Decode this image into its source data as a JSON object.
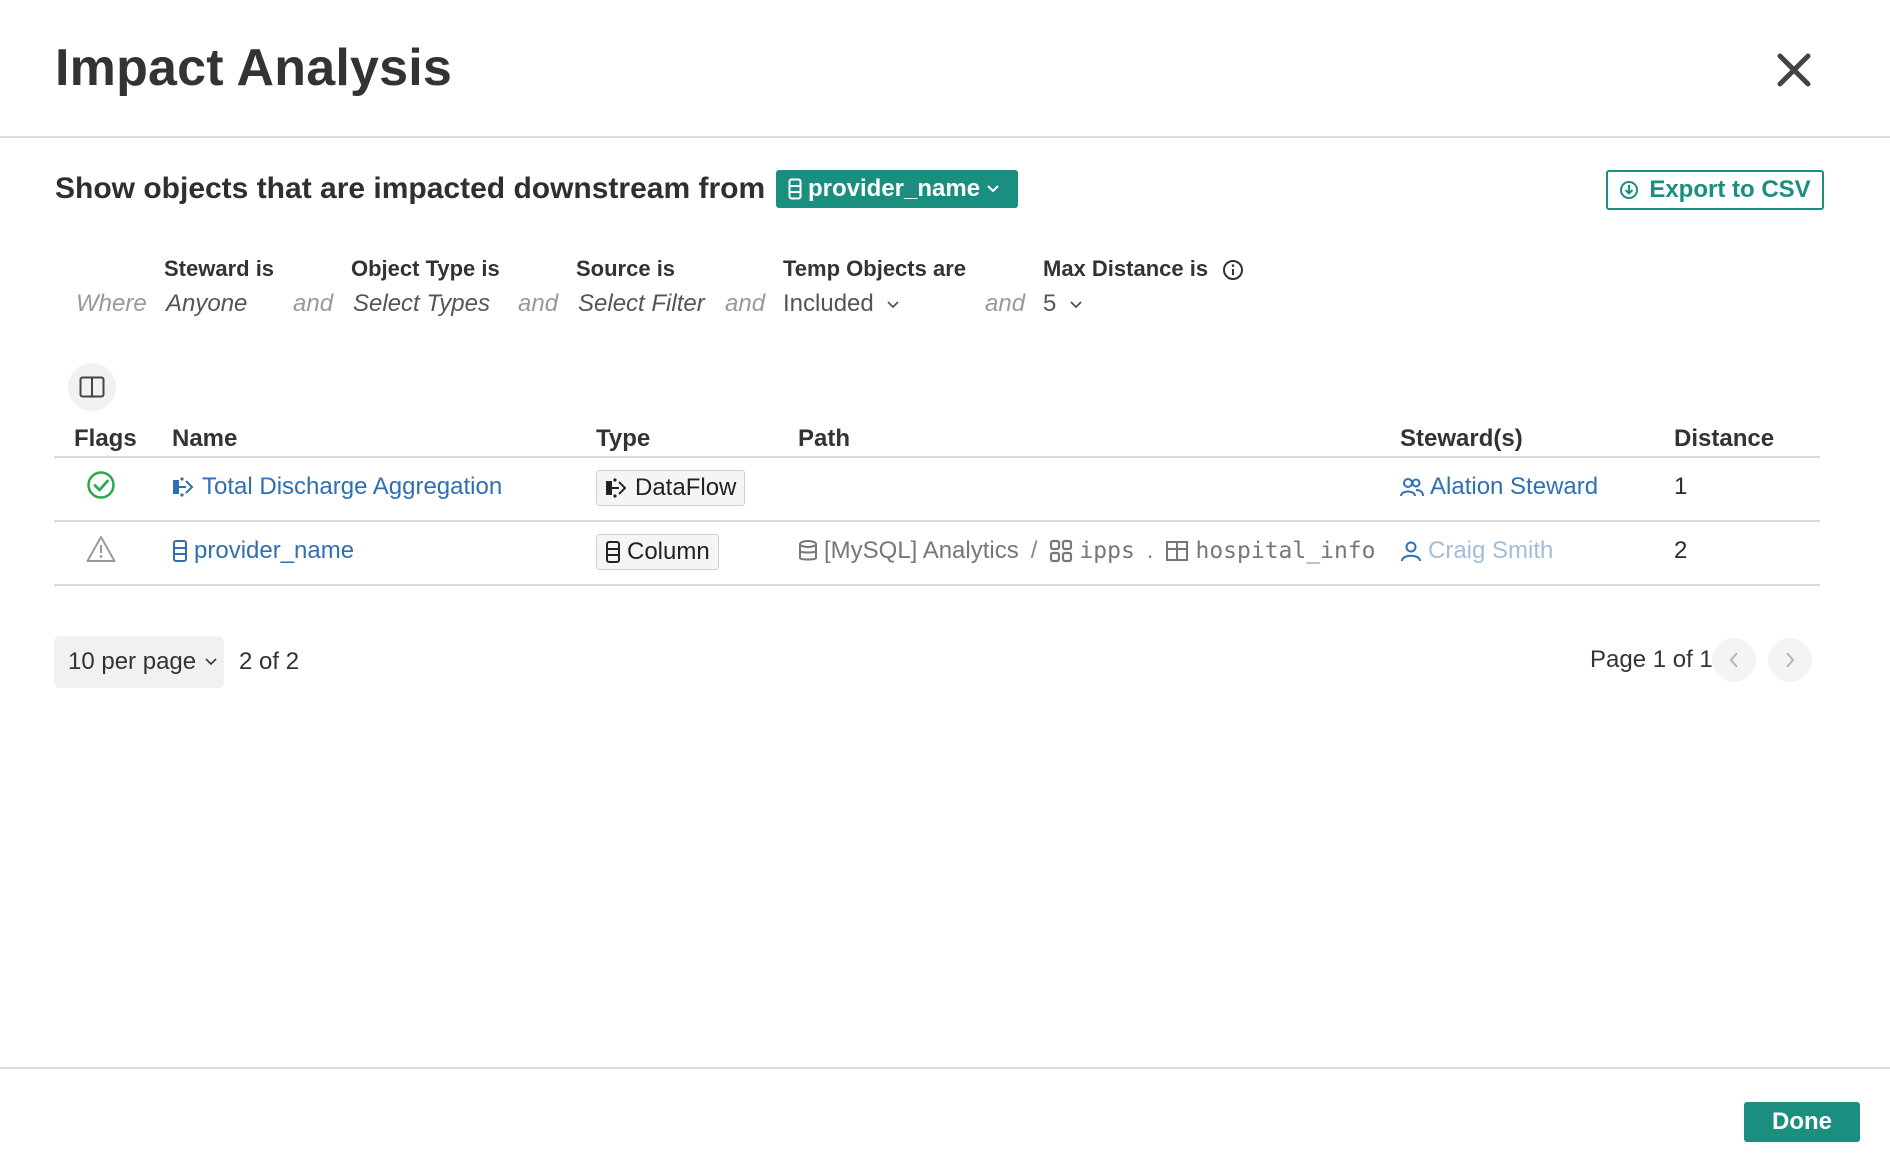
{
  "dialog": {
    "title": "Impact Analysis",
    "close_icon": "close-icon"
  },
  "header": {
    "subheading": "Show objects that are impacted downstream from",
    "source_object": "provider_name",
    "export_label": "Export to CSV"
  },
  "filters": {
    "where": "Where",
    "connector": "and",
    "steward": {
      "label": "Steward is",
      "value": "Anyone"
    },
    "object_type": {
      "label": "Object Type is",
      "value": "Select Types"
    },
    "source": {
      "label": "Source is",
      "value": "Select Filter"
    },
    "temp_objects": {
      "label": "Temp Objects are",
      "value": "Included"
    },
    "max_distance": {
      "label": "Max Distance is",
      "value": "5"
    }
  },
  "table": {
    "columns": [
      "Flags",
      "Name",
      "Type",
      "Path",
      "Steward(s)",
      "Distance"
    ],
    "rows": [
      {
        "flag": "endorsed-check-icon",
        "name": "Total Discharge Aggregation",
        "type": "DataFlow",
        "path": [],
        "steward": "Alation Steward",
        "distance": "1"
      },
      {
        "flag": "warning-triangle-icon",
        "name": "provider_name",
        "type": "Column",
        "path": [
          "[MySQL] Analytics",
          "/",
          "ipps",
          ".",
          "hospital_info"
        ],
        "steward": "Craig Smith",
        "distance": "2"
      }
    ]
  },
  "pagination": {
    "per_page": "10 per page",
    "count": "2 of 2",
    "page_info": "Page 1 of 1"
  },
  "footer": {
    "done_label": "Done"
  },
  "colors": {
    "accent": "#1a8f7f",
    "link": "#2e6fb5",
    "success": "#2fa84f",
    "warning": "#9a9a9a"
  }
}
